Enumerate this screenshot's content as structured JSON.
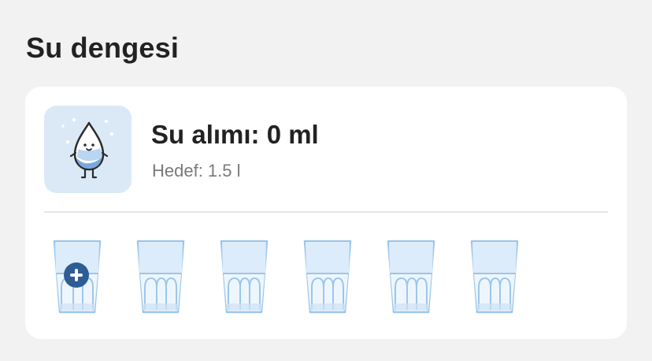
{
  "section": {
    "title": "Su dengesi"
  },
  "card": {
    "mascot_icon": "water-drop-mascot-icon",
    "intake_title": "Su alımı: 0 ml",
    "goal_text": "Hedef: 1.5 l",
    "glass_icon": "water-glass-icon",
    "add_icon": "plus-icon",
    "glasses": [
      {
        "filled": false,
        "addable": true
      },
      {
        "filled": false,
        "addable": false
      },
      {
        "filled": false,
        "addable": false
      },
      {
        "filled": false,
        "addable": false
      },
      {
        "filled": false,
        "addable": false
      },
      {
        "filled": false,
        "addable": false
      }
    ]
  },
  "colors": {
    "page_bg": "#f2f2f2",
    "card_bg": "#ffffff",
    "mascot_bg": "#dbe9f7",
    "glass_stroke": "#9cc6ec",
    "glass_fill": "#dcecfa",
    "add_button": "#2d5d94"
  }
}
